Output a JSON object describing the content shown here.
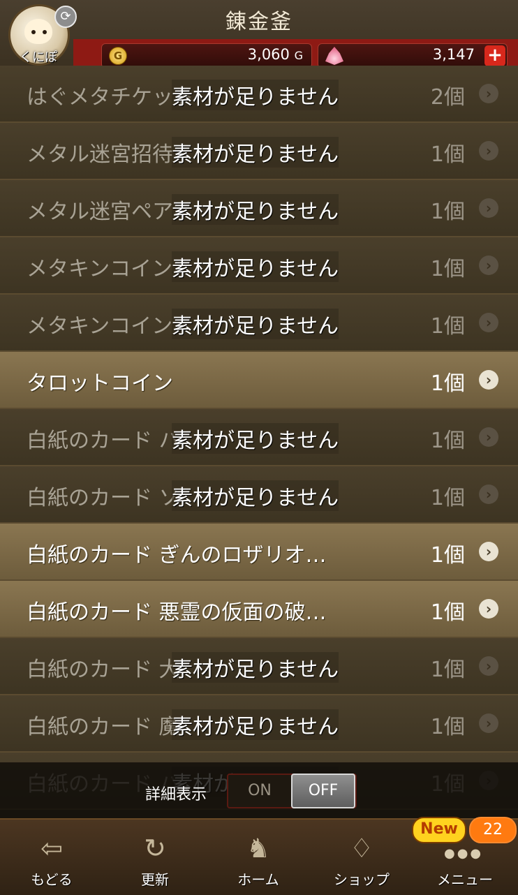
{
  "header": {
    "title": "錬金釜",
    "player_name": "くにぽ",
    "gold": "3,060",
    "gold_unit": "G",
    "gold_icon_letter": "G",
    "gems": "3,147",
    "gem_plus": "+"
  },
  "items": [
    {
      "name": "はぐメタチケット",
      "warning": "素材が足りません",
      "count": "2個",
      "available": false
    },
    {
      "name": "メタル迷宮招待",
      "warning": "素材が足りません",
      "count": "1個",
      "available": false
    },
    {
      "name": "メタル迷宮ペア",
      "warning": "素材が足りません",
      "count": "1個",
      "available": false
    },
    {
      "name": "メタキンコイン",
      "warning": "素材が足りません",
      "count": "1個",
      "available": false
    },
    {
      "name": "メタキンコイン",
      "warning": "素材が足りません",
      "count": "1個",
      "available": false
    },
    {
      "name": "タロットコイン",
      "warning": "",
      "count": "1個",
      "available": true
    },
    {
      "name": "白紙のカード ハ",
      "warning": "素材が足りません",
      "count": "1個",
      "available": false
    },
    {
      "name": "白紙のカード ソ",
      "warning": "素材が足りません",
      "count": "1個",
      "available": false
    },
    {
      "name": "白紙のカード ぎんのロザリオ…",
      "warning": "",
      "count": "1個",
      "available": true
    },
    {
      "name": "白紙のカード 悪霊の仮面の破…",
      "warning": "",
      "count": "1個",
      "available": true
    },
    {
      "name": "白紙のカード 大",
      "warning": "素材が足りません",
      "count": "1個",
      "available": false
    },
    {
      "name": "白紙のカード 魔",
      "warning": "素材が足りません",
      "count": "1個",
      "available": false
    },
    {
      "name": "白紙のカード ハ",
      "warning": "素材が足りません",
      "count": "1個",
      "available": false
    }
  ],
  "detail": {
    "label": "詳細表示",
    "on": "ON",
    "off": "OFF",
    "selected": "OFF"
  },
  "nav": {
    "items": [
      {
        "label": "もどる",
        "icon": "back-arrow-icon"
      },
      {
        "label": "更新",
        "icon": "refresh-icon"
      },
      {
        "label": "ホーム",
        "icon": "dragon-home-icon"
      },
      {
        "label": "ショップ",
        "icon": "slime-shop-icon"
      },
      {
        "label": "メニュー",
        "icon": "menu-icon"
      }
    ],
    "new_badge": "New",
    "menu_count": "22"
  }
}
